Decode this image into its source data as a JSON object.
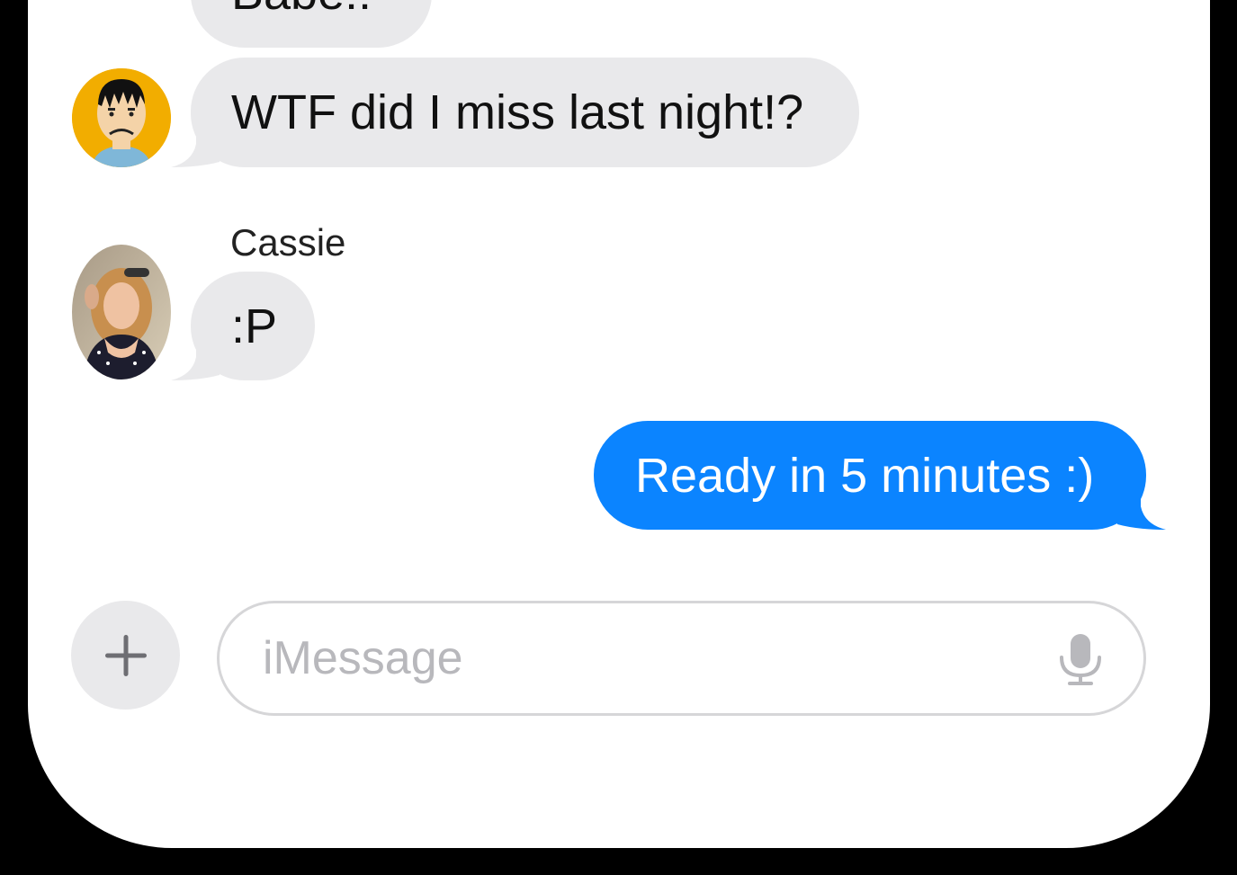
{
  "messages": [
    {
      "direction": "incoming",
      "text": "Babe!!"
    },
    {
      "direction": "incoming",
      "text": "WTF did I miss last night!?"
    },
    {
      "direction": "incoming",
      "sender": "Cassie",
      "text": ":P"
    },
    {
      "direction": "outgoing",
      "text": "Ready in 5 minutes :)"
    }
  ],
  "input": {
    "placeholder": "iMessage"
  },
  "icons": {
    "add": "plus-icon",
    "dictation": "microphone-icon"
  },
  "colors": {
    "incoming_bubble": "#e9e9eb",
    "outgoing_bubble": "#0b84ff",
    "placeholder": "#b8b8bc",
    "avatar_1_bg": "#f2ad00"
  }
}
